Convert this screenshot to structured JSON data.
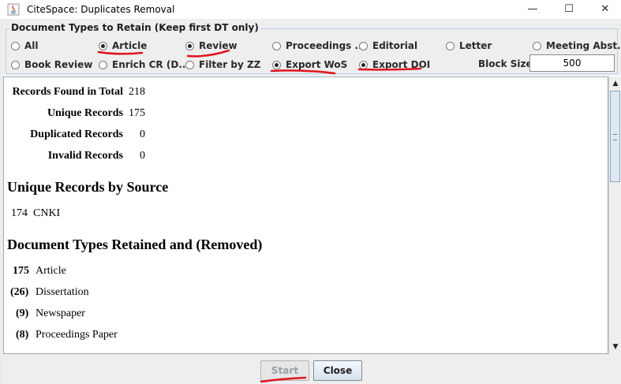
{
  "window": {
    "title": "CiteSpace: Duplicates Removal",
    "minimize_glyph": "—",
    "maximize_glyph": "☐",
    "close_glyph": "✕"
  },
  "options_group": {
    "legend": "Document Types to Retain (Keep first DT only)",
    "radios": [
      {
        "label": "All",
        "selected": false
      },
      {
        "label": "Article",
        "selected": true
      },
      {
        "label": "Review",
        "selected": true
      },
      {
        "label": "Proceedings ...",
        "selected": false
      },
      {
        "label": "Editorial",
        "selected": false
      },
      {
        "label": "Letter",
        "selected": false
      },
      {
        "label": "Meeting Abst...",
        "selected": false
      },
      {
        "label": "Book Review",
        "selected": false
      },
      {
        "label": "Enrich CR (D...",
        "selected": false
      },
      {
        "label": "Filter by ZZ",
        "selected": false
      },
      {
        "label": "Export WoS",
        "selected": true
      },
      {
        "label": "Export DOI",
        "selected": true
      }
    ],
    "block_size_label": "Block Size:",
    "block_size_value": "500"
  },
  "report": {
    "stats": [
      {
        "label": "Records Found in Total",
        "value": "218"
      },
      {
        "label": "Unique Records",
        "value": "175"
      },
      {
        "label": "Duplicated Records",
        "value": "0"
      },
      {
        "label": "Invalid Records",
        "value": "0"
      }
    ],
    "unique_by_source_heading": "Unique Records by Source",
    "sources": [
      {
        "count": "174",
        "name": "CNKI"
      }
    ],
    "doc_types_heading": "Document Types Retained and (Removed)",
    "doc_types": [
      {
        "count": "175",
        "name": "Article"
      },
      {
        "count": "(26)",
        "name": "Dissertation"
      },
      {
        "count": "(9)",
        "name": "Newspaper"
      },
      {
        "count": "(8)",
        "name": "Proceedings Paper"
      }
    ]
  },
  "buttons": {
    "start_label": "Start",
    "close_label": "Close"
  },
  "colors": {
    "annotation_red": "#e0141e",
    "selection_border": "#b8cfe5",
    "group_background": "#eeeeee"
  }
}
